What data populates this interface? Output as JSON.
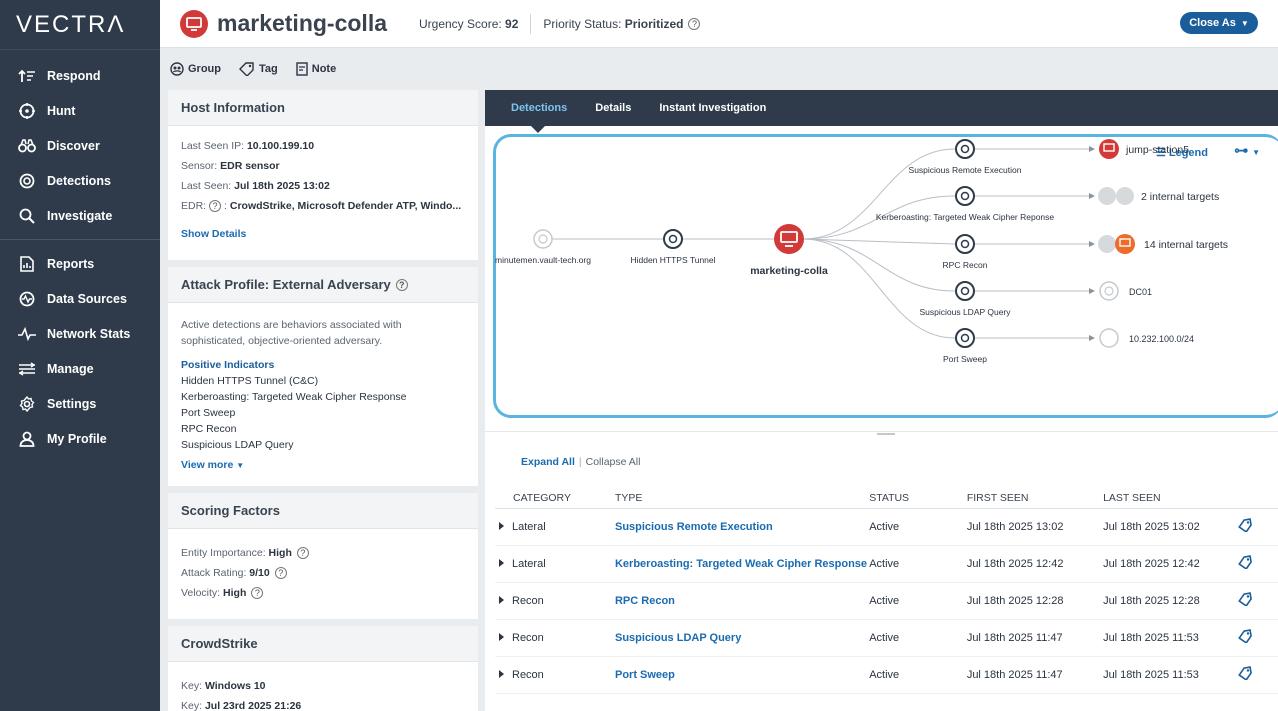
{
  "app": {
    "logo": "VECTRΛ"
  },
  "sidebar": {
    "items": [
      {
        "label": "Respond",
        "icon": "respond-icon"
      },
      {
        "label": "Hunt",
        "icon": "crosshair-icon"
      },
      {
        "label": "Discover",
        "icon": "binoculars-icon"
      },
      {
        "label": "Detections",
        "icon": "detections-icon"
      },
      {
        "label": "Investigate",
        "icon": "search-icon"
      },
      {
        "label": "Reports",
        "icon": "reports-icon"
      },
      {
        "label": "Data Sources",
        "icon": "data-sources-icon"
      },
      {
        "label": "Network Stats",
        "icon": "network-stats-icon"
      },
      {
        "label": "Manage",
        "icon": "manage-icon"
      },
      {
        "label": "Settings",
        "icon": "gear-icon"
      },
      {
        "label": "My Profile",
        "icon": "user-icon"
      }
    ]
  },
  "header": {
    "host_name": "marketing-colla",
    "urgency_label": "Urgency Score:",
    "urgency_value": "92",
    "priority_label": "Priority Status:",
    "priority_value": "Prioritized",
    "close_label": "Close As"
  },
  "toolbar": {
    "group": "Group",
    "tag": "Tag",
    "note": "Note"
  },
  "host_info": {
    "title": "Host Information",
    "last_seen_ip_label": "Last Seen IP:",
    "last_seen_ip": "10.100.199.10",
    "sensor_label": "Sensor:",
    "sensor": "EDR sensor",
    "last_seen_label": "Last Seen:",
    "last_seen": "Jul 18th 2025 13:02",
    "edr_label": "EDR:",
    "edr": "CrowdStrike, Microsoft Defender ATP, Windo...",
    "show_details": "Show Details"
  },
  "attack_profile": {
    "title": "Attack Profile: External Adversary",
    "description": "Active detections are behaviors associated with sophisticated, objective-oriented adversary.",
    "indicators_title": "Positive Indicators",
    "indicators": [
      "Hidden HTTPS Tunnel (C&C)",
      "Kerberoasting: Targeted Weak Cipher Response",
      "Port Sweep",
      "RPC Recon",
      "Suspicious LDAP Query"
    ],
    "view_more": "View more"
  },
  "scoring": {
    "title": "Scoring Factors",
    "importance_label": "Entity Importance:",
    "importance": "High",
    "rating_label": "Attack Rating:",
    "rating": "9/10",
    "velocity_label": "Velocity:",
    "velocity": "High"
  },
  "crowdstrike": {
    "title": "CrowdStrike",
    "key1_label": "Key:",
    "key1": "Windows 10",
    "key2_label": "Key:",
    "key2": "Jul 23rd 2025 21:26"
  },
  "tabs": [
    "Detections",
    "Details",
    "Instant Investigation"
  ],
  "graph": {
    "legend": "Legend",
    "source": "minutemen.vault-tech.org",
    "tunnel": "Hidden HTTPS Tunnel",
    "center": "marketing-colla",
    "detections": [
      "Suspicious Remote Execution",
      "Kerberoasting: Targeted Weak Cipher Reponse",
      "RPC Recon",
      "Suspicious LDAP Query",
      "Port Sweep"
    ],
    "targets": [
      "jump-station5",
      "2 internal targets",
      "14 internal targets",
      "DC01",
      "10.232.100.0/24"
    ]
  },
  "table": {
    "expand_all": "Expand All",
    "collapse_all": "Collapse All",
    "headers": [
      "CATEGORY",
      "TYPE",
      "STATUS",
      "FIRST SEEN",
      "LAST SEEN"
    ],
    "rows": [
      {
        "category": "Lateral",
        "type": "Suspicious Remote Execution",
        "status": "Active",
        "first": "Jul 18th 2025 13:02",
        "last": "Jul 18th 2025 13:02"
      },
      {
        "category": "Lateral",
        "type": "Kerberoasting: Targeted Weak Cipher Response",
        "status": "Active",
        "first": "Jul 18th 2025 12:42",
        "last": "Jul 18th 2025 12:42"
      },
      {
        "category": "Recon",
        "type": "RPC Recon",
        "status": "Active",
        "first": "Jul 18th 2025 12:28",
        "last": "Jul 18th 2025 12:28"
      },
      {
        "category": "Recon",
        "type": "Suspicious LDAP Query",
        "status": "Active",
        "first": "Jul 18th 2025 11:47",
        "last": "Jul 18th 2025 11:53"
      },
      {
        "category": "Recon",
        "type": "Port Sweep",
        "status": "Active",
        "first": "Jul 18th 2025 11:47",
        "last": "Jul 18th 2025 11:53"
      }
    ]
  },
  "colors": {
    "sidebar": "#2f3b4a",
    "accent": "#1a5d9a",
    "host_red": "#d23a3a",
    "graph_border": "#5ab4e0"
  }
}
